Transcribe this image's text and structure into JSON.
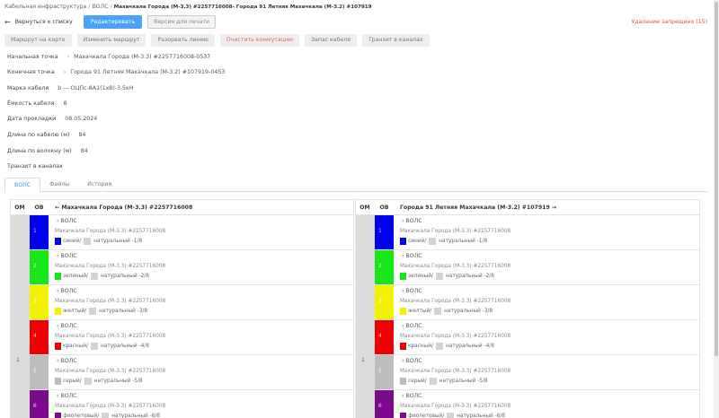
{
  "breadcrumb": {
    "root": "Кабельная инфраструктура",
    "section": "ВОЛС",
    "current": "Махачкала Города (М-3.3) #2257716008- Города 91 Летняя Махачкала (М-3.2) #107919"
  },
  "toolbar": {
    "back_label": "Вернуться к списку",
    "edit_label": "Редактировать",
    "print_label": "Версия для печати",
    "delete_note": "Удаление запрещено (15)"
  },
  "actions": [
    {
      "label": "Маршрут на карте"
    },
    {
      "label": "Изменить маршрут"
    },
    {
      "label": "Разорвать линию"
    },
    {
      "label": "Очистить коммутацию"
    },
    {
      "label": "Запас кабеля"
    },
    {
      "label": "Транзит в каналах"
    }
  ],
  "fields": {
    "start": {
      "label": "Начальная точка",
      "value": "Махачкала Города (М-3.3) #2257716008-0537"
    },
    "end": {
      "label": "Конечная точка",
      "value": "Города 91 Летняя Махачкала (М-3.2) #107919-0453"
    },
    "cable": {
      "label": "Марка кабеля",
      "value": "b — ОЦПс-8А1(1х8)-3,5кН"
    },
    "capacity": {
      "label": "Ёмкость кабеля",
      "value": "8"
    },
    "date": {
      "label": "Дата прокладки",
      "value": "08.05.2024"
    },
    "length_cable": {
      "label": "Длина по кабелю (м)",
      "value": "84"
    },
    "length_fiber": {
      "label": "Длина по волокну (м)",
      "value": "84"
    },
    "transit": {
      "label": "Транзит в каналах",
      "value": ""
    }
  },
  "tabs": [
    {
      "label": "ВОЛС"
    },
    {
      "label": "Файлы"
    },
    {
      "label": "История"
    }
  ],
  "panels": {
    "col_om": "ОМ",
    "col_ob": "ОВ",
    "left_title": "Махачкала Города (М-3.3) #2257716008",
    "right_title": "Города 91 Летняя Махачкала (М-3.2) #107919",
    "om_value": "1",
    "link_label": "ВОЛС",
    "node": "Махачкала Города (М-3.3) #2257716008",
    "natural": "натуральный"
  },
  "fibers": [
    {
      "num": "1",
      "color": "#0000ee",
      "color_name": "синий/",
      "nat_label": "натуральный -1/8"
    },
    {
      "num": "2",
      "color": "#19e619",
      "color_name": "зеленый/",
      "nat_label": "натуральный -2/8"
    },
    {
      "num": "3",
      "color": "#f2f200",
      "color_name": "желтый/",
      "nat_label": "натуральный -3/8"
    },
    {
      "num": "4",
      "color": "#ee0000",
      "color_name": "красный/",
      "nat_label": "натуральный -4/8"
    },
    {
      "num": "5",
      "color": "#bdbdbd",
      "color_name": "серый/",
      "nat_label": "натуральный -5/8"
    },
    {
      "num": "6",
      "color": "#7b0a8c",
      "color_name": "фиолетовый/",
      "nat_label": "натуральный -6/8"
    }
  ]
}
